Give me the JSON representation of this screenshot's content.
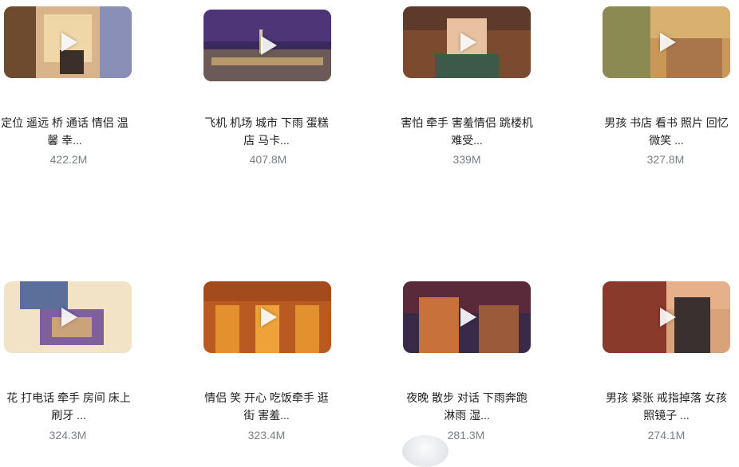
{
  "videos": [
    {
      "title_l1": "定位 遥远 桥 通话 情侣 温",
      "title_l2": "馨 幸...",
      "size": "422.2M"
    },
    {
      "title_l1": "飞机 机场 城市 下雨 蛋糕",
      "title_l2": "店 马卡...",
      "size": "407.8M"
    },
    {
      "title_l1": "害怕 牵手 害羞情侣 跳楼机",
      "title_l2": "难受...",
      "size": "339M"
    },
    {
      "title_l1": "男孩 书店 看书 照片 回忆",
      "title_l2": "微笑 ...",
      "size": "327.8M"
    },
    {
      "title_l1": "花 打电话 牵手 房间 床上",
      "title_l2": "刷牙 ...",
      "size": "324.3M"
    },
    {
      "title_l1": "情侣 笑 开心 吃饭牵手 逛",
      "title_l2": "街 害羞...",
      "size": "323.4M"
    },
    {
      "title_l1": "夜晚 散步 对话 下雨奔跑",
      "title_l2": "淋雨 湿...",
      "size": "281.3M"
    },
    {
      "title_l1": "男孩 紧张 戒指掉落 女孩",
      "title_l2": "照镜子 ...",
      "size": "274.1M"
    }
  ]
}
